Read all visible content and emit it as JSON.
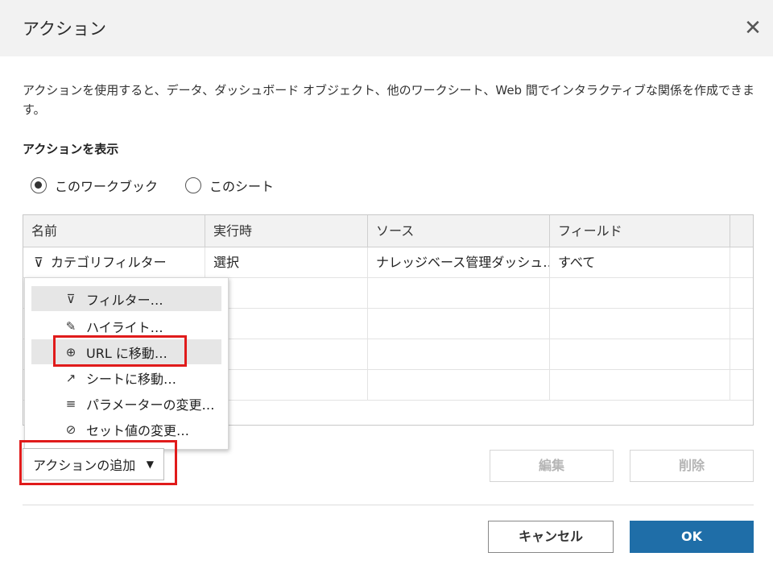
{
  "dialog": {
    "title": "アクション",
    "close_glyph": "✕",
    "description": "アクションを使用すると、データ、ダッシュボード オブジェクト、他のワークシート、Web 間でインタラクティブな関係を作成できます。",
    "section_label": "アクションを表示",
    "radios": [
      {
        "label": "このワークブック",
        "selected": true
      },
      {
        "label": "このシート",
        "selected": false
      }
    ]
  },
  "table": {
    "columns": [
      "名前",
      "実行時",
      "ソース",
      "フィールド"
    ],
    "rows": [
      {
        "icon": "filter-icon",
        "glyph": "⊽",
        "name": "カテゴリフィルター",
        "trigger": "選択",
        "source": "ナレッジベース管理ダッシュ…",
        "fields": "すべて"
      }
    ]
  },
  "add_menu": {
    "items": [
      {
        "icon": "filter-icon",
        "glyph": "⊽",
        "label": "フィルター…",
        "highlighted": true
      },
      {
        "icon": "highlight-icon",
        "glyph": "✎",
        "label": "ハイライト…",
        "highlighted": false
      },
      {
        "icon": "globe-icon",
        "glyph": "⊕",
        "label": "URL に移動…",
        "highlighted": true
      },
      {
        "icon": "go-to-sheet-icon",
        "glyph": "↗",
        "label": "シートに移動…",
        "highlighted": false
      },
      {
        "icon": "parameter-icon",
        "glyph": "≡",
        "label": "パラメーターの変更…",
        "highlighted": false
      },
      {
        "icon": "set-icon",
        "glyph": "⊘",
        "label": "セット値の変更…",
        "highlighted": false
      }
    ]
  },
  "buttons": {
    "add_action": "アクションの追加",
    "add_action_caret": "▼",
    "edit": "編集",
    "delete": "削除",
    "cancel": "キャンセル",
    "ok": "OK"
  },
  "colors": {
    "ok_button": "#1f6ea8",
    "highlight_box": "#e01b1b"
  }
}
